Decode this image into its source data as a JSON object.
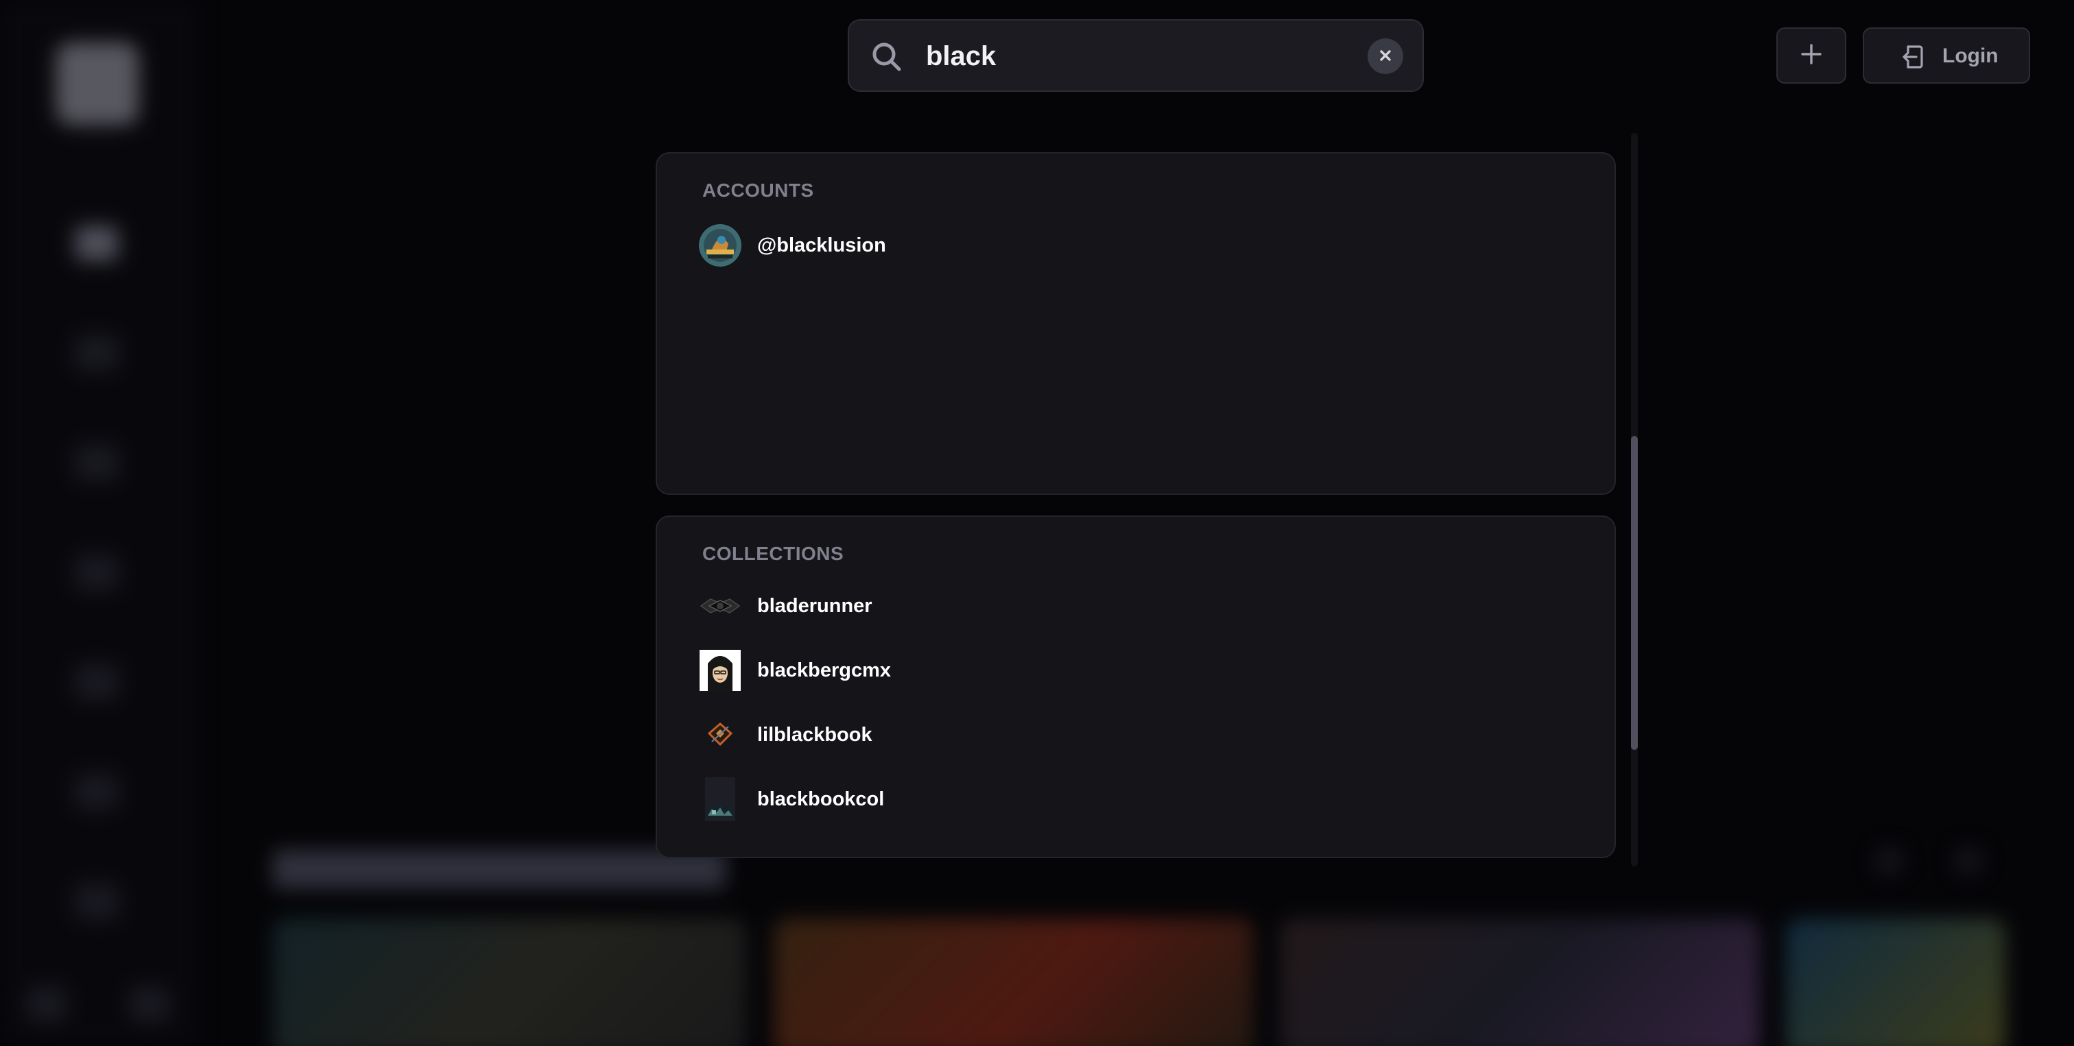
{
  "search": {
    "query": "black",
    "clear_icon": "close-icon",
    "search_icon": "search-icon"
  },
  "header": {
    "add_icon": "plus-icon",
    "login_label": "Login",
    "login_icon": "login-icon"
  },
  "results": {
    "accounts": {
      "title": "ACCOUNTS",
      "items": [
        {
          "label": "@blacklusion",
          "avatar": "blacklusion-avatar"
        }
      ]
    },
    "collections": {
      "title": "COLLECTIONS",
      "items": [
        {
          "label": "bladerunner",
          "avatar": "bladerunner-logo"
        },
        {
          "label": "blackbergcmx",
          "avatar": "blackbergcmx-logo"
        },
        {
          "label": "lilblackbook",
          "avatar": "lilblackbook-logo"
        },
        {
          "label": "blackbookcol",
          "avatar": "blackbookcol-logo"
        }
      ]
    }
  },
  "colors": {
    "background": "#050508",
    "panel": "#141419",
    "section_title": "#80808e",
    "text": "#ffffff",
    "scroll_thumb": "#50505e"
  }
}
